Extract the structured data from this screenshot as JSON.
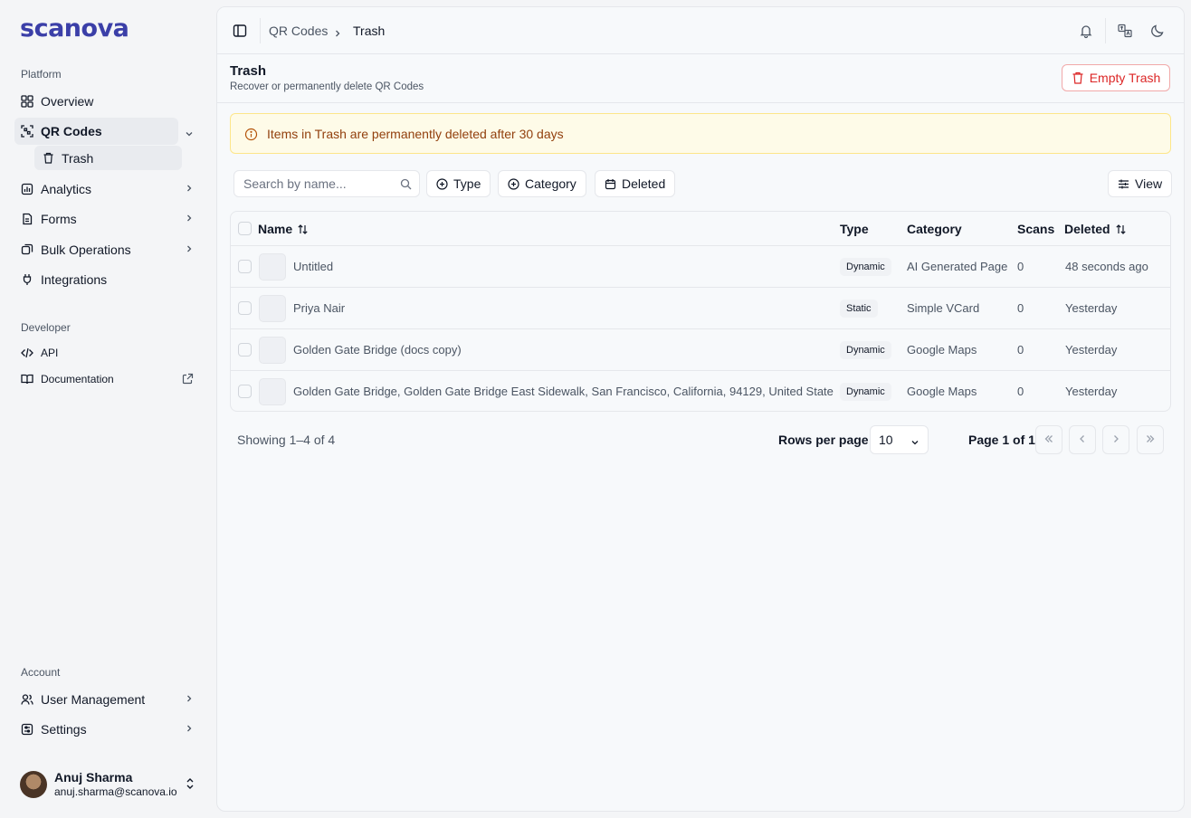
{
  "brand": {
    "logo_text": "scanova"
  },
  "sidebar": {
    "sections": {
      "platform": "Platform",
      "developer": "Developer",
      "account": "Account"
    },
    "items": {
      "overview": "Overview",
      "qr_codes": "QR Codes",
      "trash": "Trash",
      "analytics": "Analytics",
      "forms": "Forms",
      "bulk_operations": "Bulk Operations",
      "integrations": "Integrations",
      "api": "API",
      "documentation": "Documentation",
      "user_management": "User Management",
      "settings": "Settings"
    },
    "user": {
      "name": "Anuj Sharma",
      "email": "anuj.sharma@scanova.io"
    }
  },
  "topbar": {
    "breadcrumb": [
      "QR Codes",
      "Trash"
    ]
  },
  "page": {
    "title": "Trash",
    "subtitle": "Recover or permanently delete QR Codes",
    "empty_trash_label": "Empty Trash",
    "alert": "Items in Trash are permanently deleted after 30 days"
  },
  "toolbar": {
    "search_placeholder": "Search by name...",
    "filters": {
      "type": "Type",
      "category": "Category",
      "deleted": "Deleted"
    },
    "view_label": "View"
  },
  "table": {
    "headers": {
      "name": "Name",
      "type": "Type",
      "category": "Category",
      "scans": "Scans",
      "deleted": "Deleted"
    },
    "rows": [
      {
        "name": "Untitled",
        "type": "Dynamic",
        "category": "AI Generated Page",
        "scans": "0",
        "deleted": "48 seconds ago"
      },
      {
        "name": "Priya Nair",
        "type": "Static",
        "category": "Simple VCard",
        "scans": "0",
        "deleted": "Yesterday"
      },
      {
        "name": "Golden Gate Bridge (docs copy)",
        "type": "Dynamic",
        "category": "Google Maps",
        "scans": "0",
        "deleted": "Yesterday"
      },
      {
        "name": "Golden Gate Bridge, Golden Gate Bridge East Sidewalk, San Francisco, California, 94129, United State",
        "type": "Dynamic",
        "category": "Google Maps",
        "scans": "0",
        "deleted": "Yesterday"
      }
    ]
  },
  "pagination": {
    "showing": "Showing 1–4 of 4",
    "rows_per_page_label": "Rows per page",
    "rows_per_page_value": "10",
    "page_label": "Page 1 of 1"
  },
  "colors": {
    "brand": "#3b3fa8",
    "danger": "#dc2626",
    "alert_bg": "#fefbe8",
    "alert_text": "#92400e"
  },
  "icons": {
    "nav": [
      "grid-icon",
      "qr-scan-icon",
      "trash-icon",
      "chart-icon",
      "form-icon",
      "layers-icon",
      "plug-icon",
      "code-icon",
      "book-icon",
      "external-link-icon",
      "users-icon",
      "settings-icon"
    ],
    "topbar": [
      "sidebar-toggle-icon",
      "bell-icon",
      "translate-icon",
      "moon-icon"
    ]
  }
}
